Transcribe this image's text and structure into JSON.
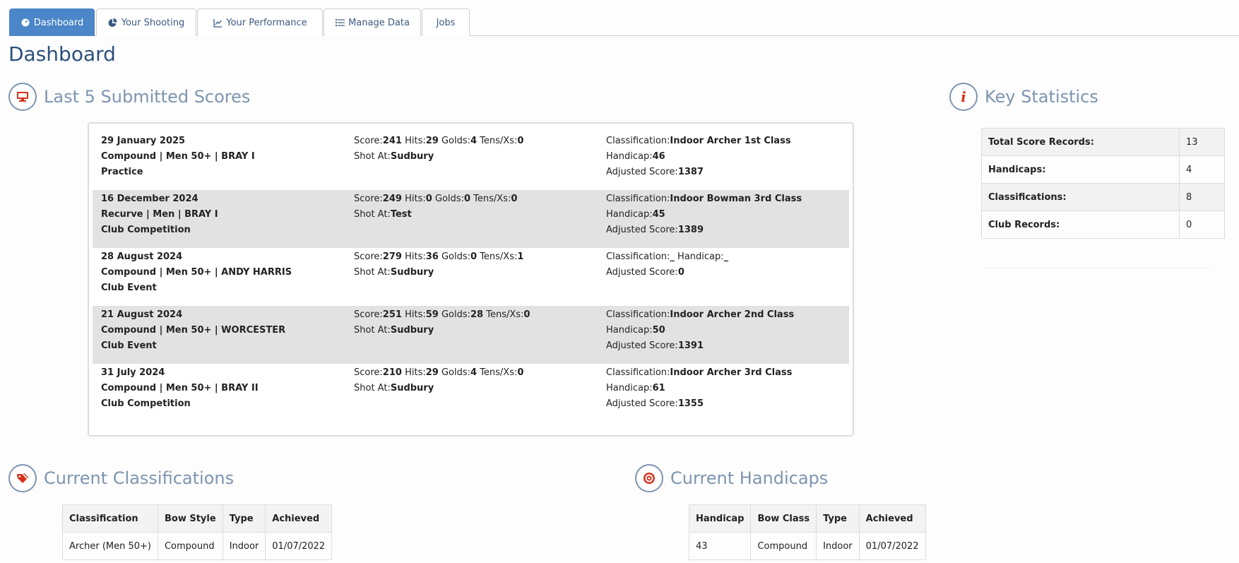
{
  "tabs": [
    {
      "label": "Dashboard",
      "icon": "dashboard-icon",
      "active": true
    },
    {
      "label": "Your Shooting",
      "icon": "pie-chart-icon",
      "active": false
    },
    {
      "label": "Your Performance",
      "icon": "line-chart-icon",
      "active": false
    },
    {
      "label": "Manage Data",
      "icon": "list-icon",
      "active": false
    },
    {
      "label": "Jobs",
      "icon": "",
      "active": false
    }
  ],
  "page_title": "Dashboard",
  "last_scores": {
    "title": "Last 5 Submitted Scores",
    "icon": "monitor-icon",
    "rows": [
      {
        "date": "29 January 2025",
        "round": "Compound | Men 50+ | BRAY I",
        "event": "Practice",
        "score": "241",
        "hits": "29",
        "golds": "4",
        "tens": "0",
        "shot_at": "Sudbury",
        "classification": "Indoor Archer 1st Class",
        "handicap": "46",
        "adjusted": "1387"
      },
      {
        "date": "16 December 2024",
        "round": "Recurve | Men | BRAY I",
        "event": "Club Competition",
        "score": "249",
        "hits": "0",
        "golds": "0",
        "tens": "0",
        "shot_at": "Test",
        "classification": "Indoor Bowman 3rd Class",
        "handicap": "45",
        "adjusted": "1389"
      },
      {
        "date": "28 August 2024",
        "round": "Compound | Men 50+ | ANDY HARRIS",
        "event": "Club Event",
        "score": "279",
        "hits": "36",
        "golds": "0",
        "tens": "1",
        "shot_at": "Sudbury",
        "classification": "_",
        "handicap": "_",
        "adjusted": "0"
      },
      {
        "date": "21 August 2024",
        "round": "Compound | Men 50+ | WORCESTER",
        "event": "Club Event",
        "score": "251",
        "hits": "59",
        "golds": "28",
        "tens": "0",
        "shot_at": "Sudbury",
        "classification": "Indoor Archer 2nd Class",
        "handicap": "50",
        "adjusted": "1391"
      },
      {
        "date": "31 July 2024",
        "round": "Compound | Men 50+ | BRAY II",
        "event": "Club Competition",
        "score": "210",
        "hits": "29",
        "golds": "4",
        "tens": "0",
        "shot_at": "Sudbury",
        "classification": "Indoor Archer 3rd Class",
        "handicap": "61",
        "adjusted": "1355"
      }
    ],
    "labels": {
      "score": "Score:",
      "hits": "Hits:",
      "golds": "Golds:",
      "tens": "Tens/Xs:",
      "shot_at": "Shot At:",
      "classification": "Classification:",
      "handicap": "Handicap:",
      "adjusted": "Adjusted Score:"
    }
  },
  "key_stats": {
    "title": "Key Statistics",
    "icon": "info-icon",
    "rows": [
      {
        "label": "Total Score Records:",
        "value": "13"
      },
      {
        "label": "Handicaps:",
        "value": "4"
      },
      {
        "label": "Classifications:",
        "value": "8"
      },
      {
        "label": "Club Records:",
        "value": "0"
      }
    ]
  },
  "classifications": {
    "title": "Current Classifications",
    "icon": "tags-icon",
    "headers": [
      "Classification",
      "Bow Style",
      "Type",
      "Achieved"
    ],
    "rows": [
      [
        "Archer (Men 50+)",
        "Compound",
        "Indoor",
        "01/07/2022"
      ]
    ]
  },
  "handicaps": {
    "title": "Current Handicaps",
    "icon": "target-icon",
    "headers": [
      "Handicap",
      "Bow Class",
      "Type",
      "Achieved"
    ],
    "rows": [
      [
        "43",
        "Compound",
        "Indoor",
        "01/07/2022"
      ]
    ]
  },
  "colors": {
    "accent": "#4a86c8",
    "icon_red": "#d8311a",
    "heading_muted": "#7d95b0",
    "title": "#2c4f7c"
  }
}
